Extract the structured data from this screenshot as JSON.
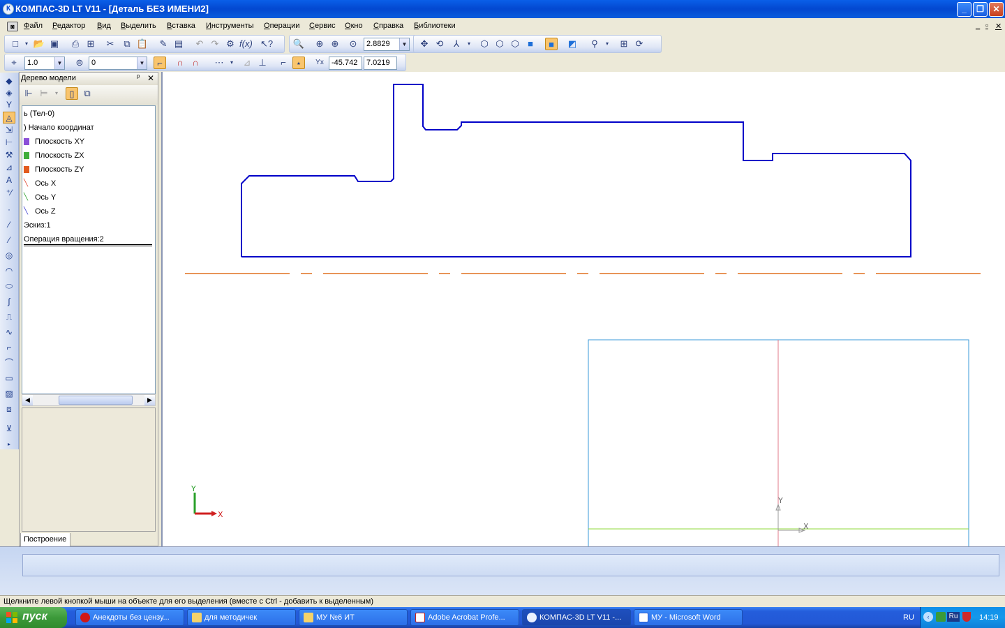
{
  "window": {
    "title": "КОМПАС-3D LT V11 - [Деталь БЕЗ ИМЕНИ2]",
    "app_icon_letter": "К",
    "minimize": "_",
    "restore": "❐",
    "close": "✕"
  },
  "menu": {
    "items": [
      "Файл",
      "Редактор",
      "Вид",
      "Выделить",
      "Вставка",
      "Инструменты",
      "Операции",
      "Сервис",
      "Окно",
      "Справка",
      "Библиотеки"
    ],
    "doc_controls": [
      "_",
      "▫",
      "✕"
    ]
  },
  "toolbar1": {
    "zoom_value": "2.8829"
  },
  "toolbar2": {
    "step_value": "1.0",
    "layer_value": "0",
    "coord_x": "-45.742",
    "coord_y": "7.0219"
  },
  "tree": {
    "header": "Дерево модели",
    "pin": "ᵖ",
    "close": "✕",
    "items": [
      {
        "label": "ь (Тел-0)",
        "icon_color": ""
      },
      {
        "label": ") Начало координат",
        "icon_color": ""
      },
      {
        "label": "Плоскость XY",
        "icon_color": "#8a4fd8"
      },
      {
        "label": "Плоскость ZX",
        "icon_color": "#3fae3a"
      },
      {
        "label": "Плоскость ZY",
        "icon_color": "#e25b1e"
      },
      {
        "label": "Ось X",
        "icon_color": "#e0402a"
      },
      {
        "label": "Ось Y",
        "icon_color": "#2aa02a"
      },
      {
        "label": "Ось Z",
        "icon_color": "#3a3ad0"
      },
      {
        "label": "Эскиз:1",
        "icon_color": ""
      },
      {
        "label": "Операция вращения:2",
        "icon_color": ""
      }
    ],
    "tab_label": "Построение"
  },
  "canvas": {
    "profile_color": "#0000c8",
    "axis_color": "#e07020",
    "frame_color": "#3a9ad8",
    "triad_y": "Y",
    "triad_x": "X",
    "mini_y": "Y",
    "mini_x": "X"
  },
  "status": {
    "text": "Щелкните левой кнопкой мыши на объекте для его выделения (вместе с Ctrl - добавить к выделенным)"
  },
  "taskbar": {
    "start_label": "пуск",
    "tasks": [
      {
        "label": "Анекдоты без цензу...",
        "icon": "opera-icon"
      },
      {
        "label": "для методичек",
        "icon": "folder-icon"
      },
      {
        "label": "МУ №6 ИТ",
        "icon": "folder-icon"
      },
      {
        "label": "Adobe Acrobat Profe...",
        "icon": "acrobat-icon"
      },
      {
        "label": "КОМПАС-3D LT V11 -...",
        "icon": "kompas-icon"
      },
      {
        "label": "МУ - Microsoft Word",
        "icon": "word-icon"
      }
    ],
    "lang": "RU",
    "kbd": "Ru",
    "clock": "14:19"
  }
}
